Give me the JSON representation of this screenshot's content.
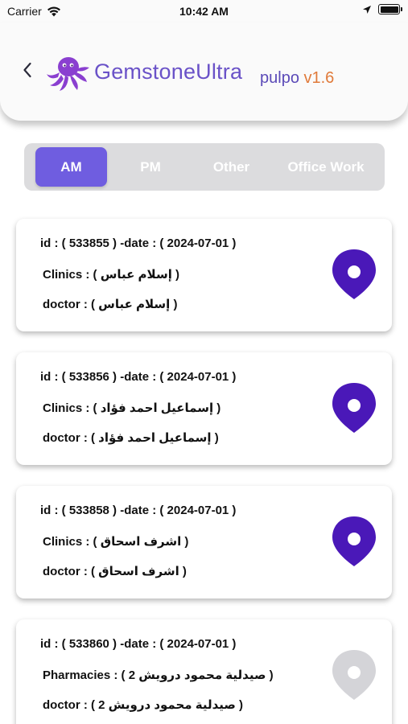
{
  "status_bar": {
    "carrier": "Carrier",
    "time": "10:42 AM"
  },
  "header": {
    "brand": "GemstoneUltra",
    "subtitle_name": "pulpo",
    "version": "v1.6",
    "brand_color": "#6a52c8",
    "version_color": "#e07a3a"
  },
  "tabs": [
    {
      "label": "AM",
      "active": true
    },
    {
      "label": "PM",
      "active": false
    },
    {
      "label": "Other",
      "active": false
    },
    {
      "label": "Office Work",
      "active": false
    }
  ],
  "visits": [
    {
      "id_line": "id : ( 533855 ) -date : ( 2024-07-01 )",
      "place_line": "Clinics : ( إسلام عباس )",
      "doctor_line": "doctor : ( إسلام عباس )",
      "pin_color": "#4a18b8"
    },
    {
      "id_line": "id : ( 533856 ) -date : ( 2024-07-01 )",
      "place_line": "Clinics : ( إسماعيل احمد فؤاد )",
      "doctor_line": "doctor : ( إسماعيل احمد فؤاد )",
      "pin_color": "#4a18b8"
    },
    {
      "id_line": "id : ( 533858 ) -date : ( 2024-07-01 )",
      "place_line": "Clinics : ( اشرف اسحاق )",
      "doctor_line": "doctor : ( اشرف اسحاق )",
      "pin_color": "#4a18b8"
    },
    {
      "id_line": "id : ( 533860 ) -date : ( 2024-07-01 )",
      "place_line": "Pharmacies : ( صيدلية محمود درويش 2 )",
      "doctor_line": "doctor : ( صيدلية محمود درويش 2 )",
      "pin_color": "#d4d4d8"
    }
  ]
}
